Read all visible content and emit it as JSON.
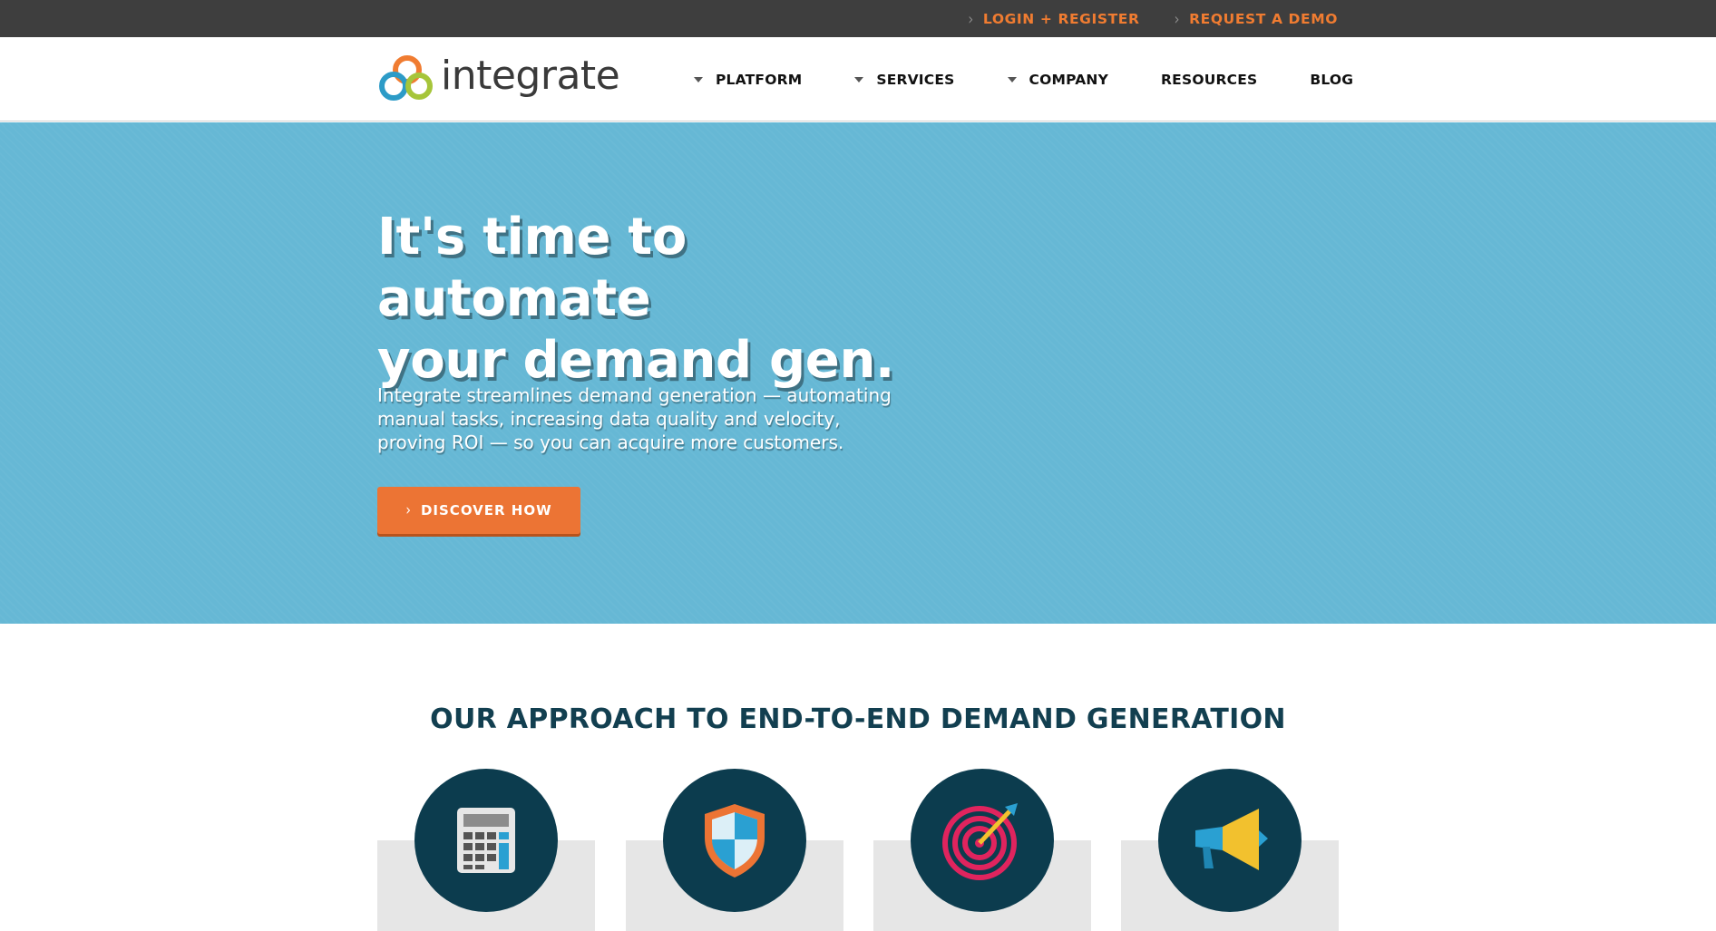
{
  "utility_nav": {
    "links": [
      {
        "label": "LOGIN + REGISTER"
      },
      {
        "label": "REQUEST A DEMO"
      }
    ]
  },
  "brand": {
    "name": "integrate",
    "logo_colors": [
      "#f07c31",
      "#2c9bc7",
      "#a6c53a"
    ]
  },
  "main_nav": {
    "items": [
      {
        "label": "PLATFORM",
        "has_dropdown": true
      },
      {
        "label": "SERVICES",
        "has_dropdown": true
      },
      {
        "label": "COMPANY",
        "has_dropdown": true
      },
      {
        "label": "RESOURCES",
        "has_dropdown": false
      },
      {
        "label": "BLOG",
        "has_dropdown": false
      }
    ]
  },
  "hero": {
    "title_line1": "It's time to automate",
    "title_line2": "your demand gen.",
    "subtitle_line1": "Integrate streamlines demand generation — automating",
    "subtitle_line2": "manual tasks, increasing data quality and velocity,",
    "subtitle_line3": "proving ROI — so you can acquire more customers.",
    "cta_label": "DISCOVER HOW",
    "background_color": "#66b8d5",
    "cta_color": "#ec7434"
  },
  "approach": {
    "title": "OUR APPROACH TO END-TO-END DEMAND GENERATION",
    "cards": [
      {
        "icon": "calculator-icon"
      },
      {
        "icon": "shield-icon"
      },
      {
        "icon": "target-icon"
      },
      {
        "icon": "megaphone-icon"
      }
    ]
  },
  "colors": {
    "utility_bar": "#3e3e3e",
    "accent": "#f07c31",
    "dark_teal": "#0c3c4e"
  }
}
